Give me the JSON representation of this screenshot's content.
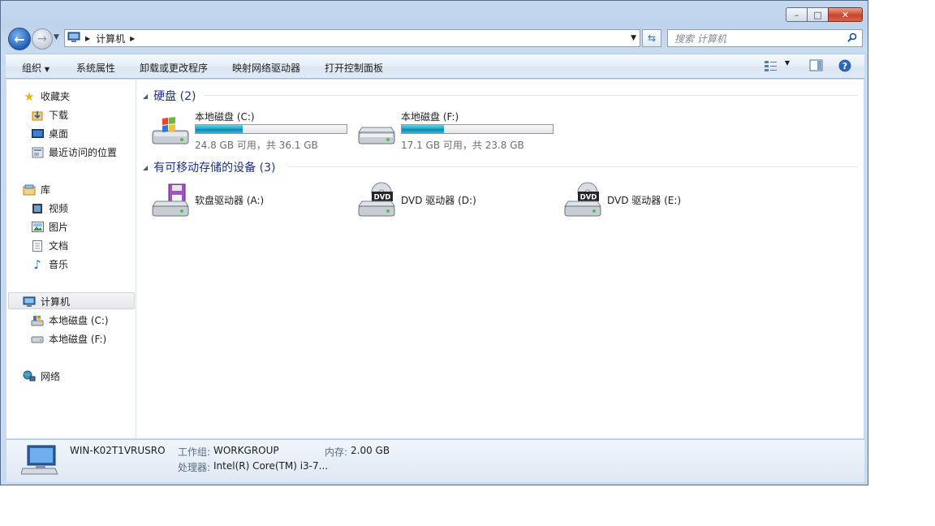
{
  "window": {
    "caption": {
      "minimize": "–",
      "maximize": "□",
      "close": "✕"
    }
  },
  "address": {
    "crumb": "计算机",
    "search_placeholder": "搜索 计算机"
  },
  "toolbar": {
    "organize": "组织",
    "system_properties": "系统属性",
    "uninstall": "卸载或更改程序",
    "map_drive": "映射网络驱动器",
    "control_panel": "打开控制面板"
  },
  "sidebar": {
    "favorites": {
      "header": "收藏夹",
      "items": [
        "下载",
        "桌面",
        "最近访问的位置"
      ]
    },
    "libraries": {
      "header": "库",
      "items": [
        "视频",
        "图片",
        "文档",
        "音乐"
      ]
    },
    "computer": {
      "header": "计算机",
      "items": [
        "本地磁盘 (C:)",
        "本地磁盘 (F:)"
      ]
    },
    "network": {
      "header": "网络"
    }
  },
  "content": {
    "hard_disks": {
      "header": "硬盘 (2)",
      "drives": [
        {
          "name": "本地磁盘 (C:)",
          "capacity": "24.8 GB 可用，共 36.1 GB",
          "used_fraction": 0.31
        },
        {
          "name": "本地磁盘 (F:)",
          "capacity": "17.1 GB 可用，共 23.8 GB",
          "used_fraction": 0.28
        }
      ]
    },
    "removable": {
      "header": "有可移动存储的设备 (3)",
      "devices": [
        "软盘驱动器 (A:)",
        "DVD 驱动器 (D:)",
        "DVD 驱动器 (E:)"
      ],
      "dvd_label": "DVD"
    }
  },
  "details": {
    "computer_name": "WIN-K02T1VRUSRO",
    "workgroup_label": "工作组:",
    "workgroup": "WORKGROUP",
    "memory_label": "内存:",
    "memory": "2.00 GB",
    "processor_label": "处理器:",
    "processor": "Intel(R) Core(TM) i3-7..."
  }
}
